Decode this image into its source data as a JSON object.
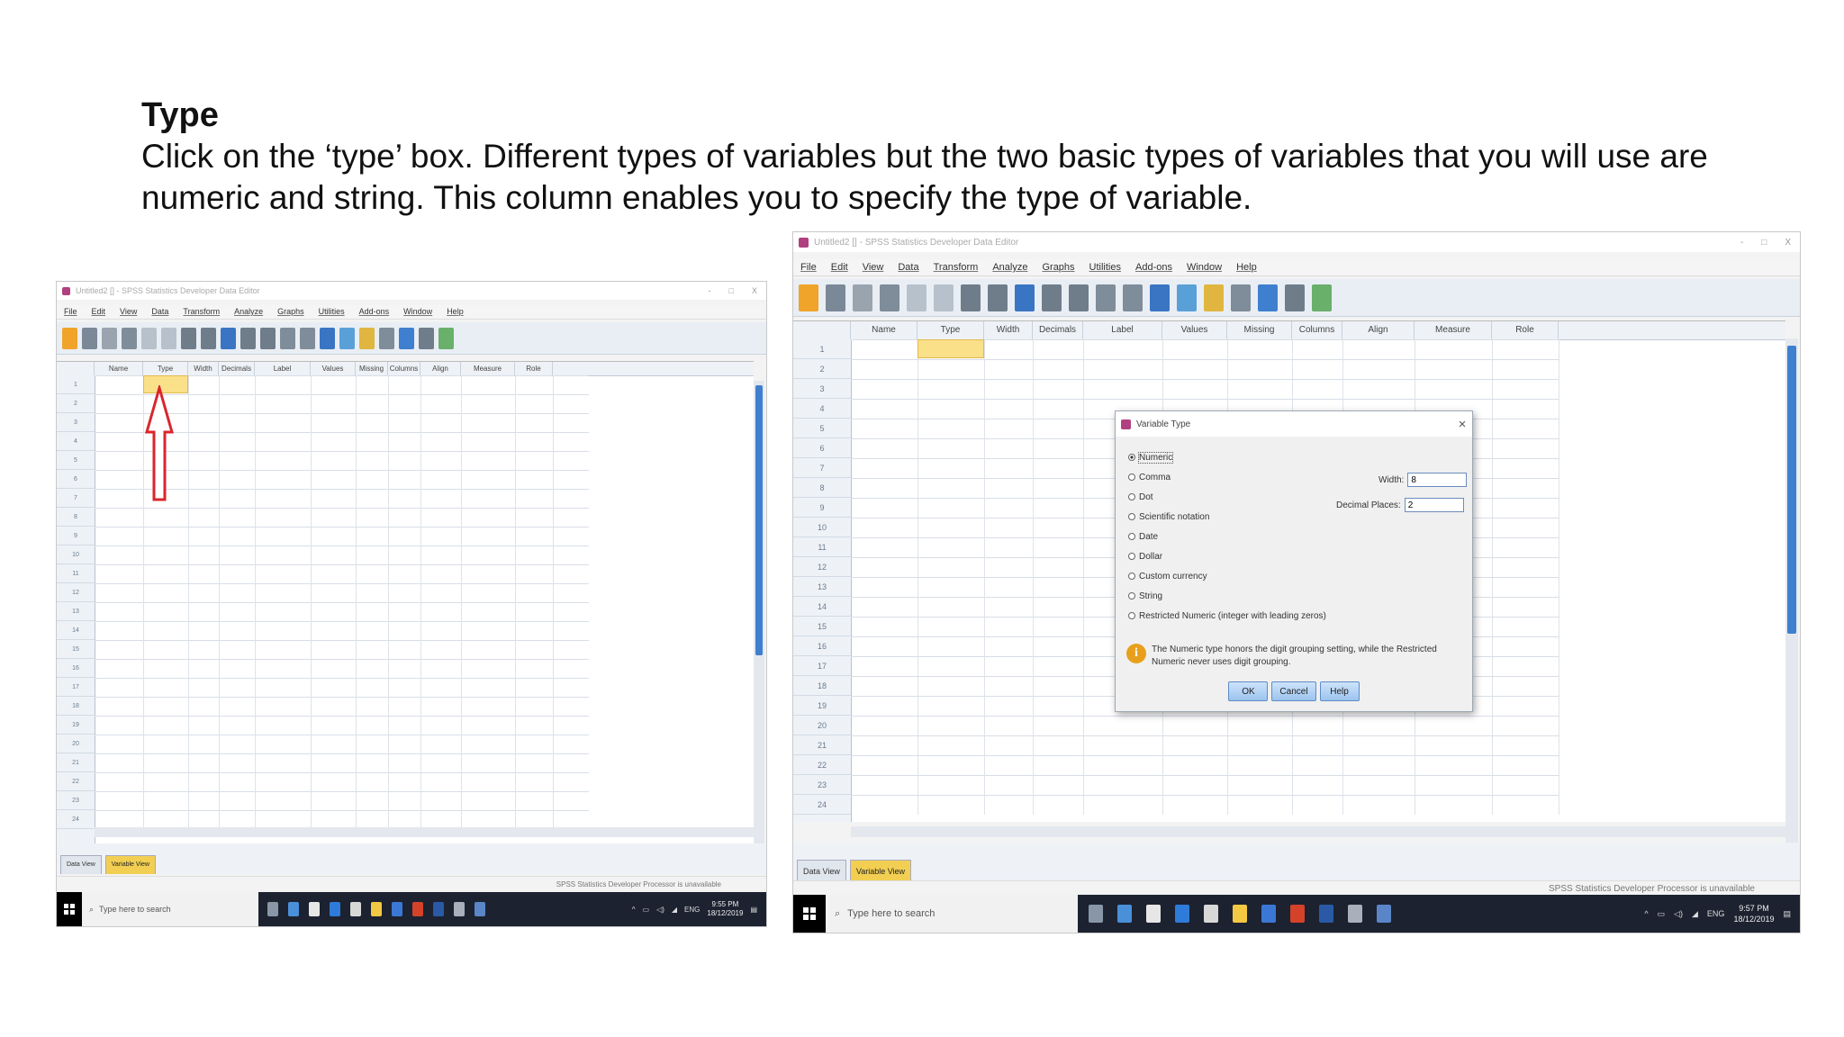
{
  "slide": {
    "title": "Type",
    "body": "Click on the ‘type’ box. Different types of variables but the two basic types of variables that you will use are numeric and string. This column enables you to specify the type of variable."
  },
  "spss_left": {
    "window_title": "Untitled2 [] - SPSS Statistics Developer Data Editor",
    "window_controls": [
      "-",
      "□",
      "X"
    ],
    "menu": [
      "File",
      "Edit",
      "View",
      "Data",
      "Transform",
      "Analyze",
      "Graphs",
      "Utilities",
      "Add-ons",
      "Window",
      "Help"
    ],
    "columns": [
      "Name",
      "Type",
      "Width",
      "Decimals",
      "Label",
      "Values",
      "Missing",
      "Columns",
      "Align",
      "Measure",
      "Role"
    ],
    "rows": [
      "1",
      "2",
      "3",
      "4",
      "5",
      "6",
      "7",
      "8",
      "9",
      "10",
      "11",
      "12",
      "13",
      "14",
      "15",
      "16",
      "17",
      "18",
      "19",
      "20",
      "21",
      "22",
      "23",
      "24"
    ],
    "tabs": [
      "Data View",
      "Variable View"
    ],
    "status": "SPSS Statistics Developer Processor is unavailable",
    "taskbar": {
      "search_placeholder": "Type here to search",
      "lang": "ENG",
      "time": "9:55 PM",
      "date": "18/12/2019"
    }
  },
  "spss_right": {
    "window_title": "Untitled2 [] - SPSS Statistics Developer Data Editor",
    "window_controls": [
      "-",
      "□",
      "X"
    ],
    "menu": [
      "File",
      "Edit",
      "View",
      "Data",
      "Transform",
      "Analyze",
      "Graphs",
      "Utilities",
      "Add-ons",
      "Window",
      "Help"
    ],
    "columns": [
      "Name",
      "Type",
      "Width",
      "Decimals",
      "Label",
      "Values",
      "Missing",
      "Columns",
      "Align",
      "Measure",
      "Role"
    ],
    "rows": [
      "1",
      "2",
      "3",
      "4",
      "5",
      "6",
      "7",
      "8",
      "9",
      "10",
      "11",
      "12",
      "13",
      "14",
      "15",
      "16",
      "17",
      "18",
      "19",
      "20",
      "21",
      "22",
      "23",
      "24"
    ],
    "tabs": [
      "Data View",
      "Variable View"
    ],
    "status": "SPSS Statistics Developer Processor is unavailable",
    "taskbar": {
      "search_placeholder": "Type here to search",
      "lang": "ENG",
      "time": "9:57 PM",
      "date": "18/12/2019"
    }
  },
  "dialog": {
    "title": "Variable Type",
    "close": "×",
    "options": [
      "Numeric",
      "Comma",
      "Dot",
      "Scientific notation",
      "Date",
      "Dollar",
      "Custom currency",
      "String",
      "Restricted Numeric (integer with leading zeros)"
    ],
    "selected": "Numeric",
    "width_label": "Width:",
    "width_value": "8",
    "decimal_label": "Decimal Places:",
    "decimal_value": "2",
    "info_icon": "i",
    "info_text": "The Numeric type honors the digit grouping setting, while the Restricted Numeric never uses digit grouping.",
    "buttons": [
      "OK",
      "Cancel",
      "Help"
    ]
  },
  "colors": {
    "highlight": "#fbe08a",
    "arrow": "#d9262e",
    "active_tab": "#f2cf52",
    "scroll": "#3f7fd0"
  },
  "icons": [
    "app-icon",
    "toolbar-icons",
    "windows-start-icon",
    "search-icon",
    "red-up-arrow-annotation",
    "info-icon"
  ]
}
